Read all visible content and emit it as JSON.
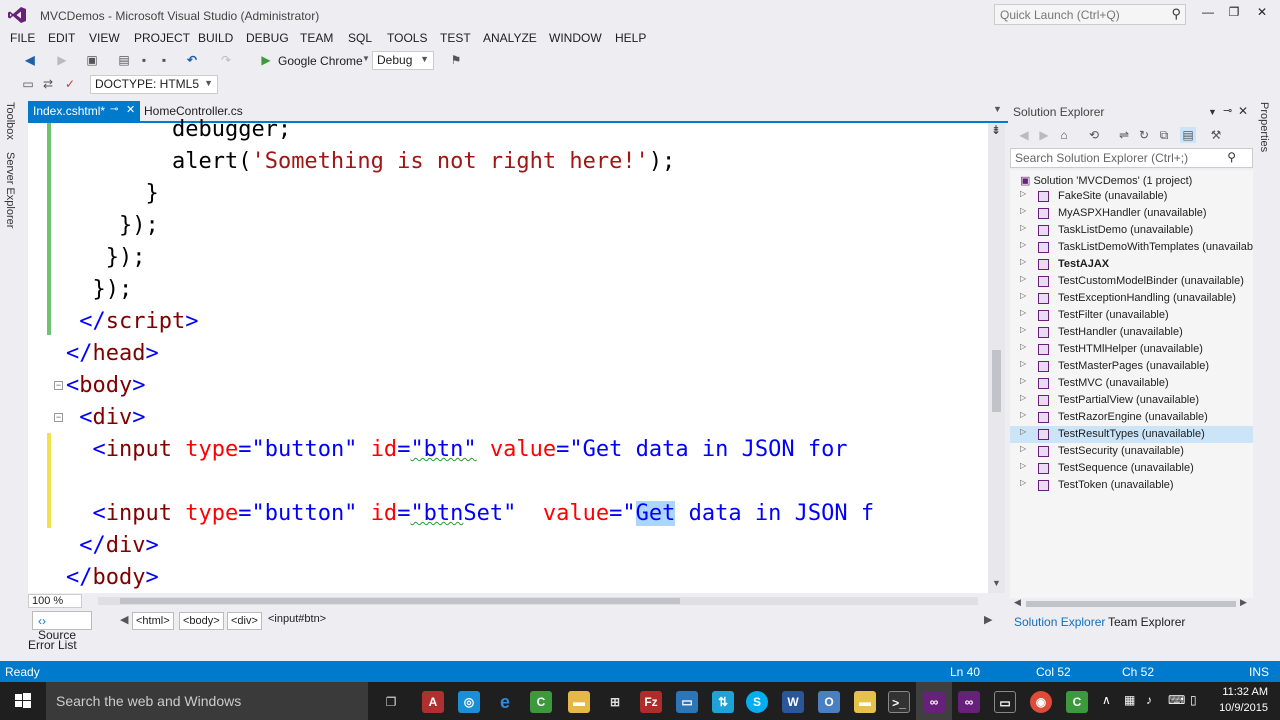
{
  "window": {
    "title": "MVCDemos - Microsoft Visual Studio (Administrator)",
    "quick_launch_placeholder": "Quick Launch (Ctrl+Q)"
  },
  "menu": [
    "FILE",
    "EDIT",
    "VIEW",
    "PROJECT",
    "BUILD",
    "DEBUG",
    "TEAM",
    "SQL",
    "TOOLS",
    "TEST",
    "ANALYZE",
    "WINDOW",
    "HELP"
  ],
  "toolbar": {
    "browser": "Google Chrome",
    "configuration": "Debug",
    "doctype": "DOCTYPE: HTML5"
  },
  "side_tabs": {
    "toolbox": "Toolbox",
    "server_explorer": "Server Explorer",
    "properties": "Properties"
  },
  "tabs": {
    "active": "Index.cshtml*",
    "second": "HomeController.cs"
  },
  "code": {
    "l1": "debugger;",
    "l2_fn": "alert(",
    "l2_str": "'Something is not right here!'",
    "l2_end": ");",
    "l3": "}",
    "l4": "});",
    "l5": "});",
    "l6": "});",
    "script_close": "script",
    "head_close": "head",
    "body_open": "body",
    "div_open": "div",
    "input_tag": "input",
    "type_attr": "type",
    "type_val": "\"button\"",
    "id_attr": "id",
    "id1": "\"btn\"",
    "value_attr": "value",
    "value1": "\"Get data in JSON for",
    "id2_pre": "\"btn",
    "id2_post": "Set\"",
    "value2_open": "\"",
    "value2_sel": "Get",
    "value2_rest": " data in JSON f",
    "div_close": "div",
    "body_close": "body"
  },
  "editor_footer": {
    "zoom": "100 %",
    "source": "Source",
    "crumbs": [
      "<html>",
      "<body>",
      "<div>",
      "<input#btn>"
    ],
    "error_list": "Error List"
  },
  "solution_explorer": {
    "title": "Solution Explorer",
    "search_placeholder": "Search Solution Explorer (Ctrl+;)",
    "root": "Solution 'MVCDemos' (1 project)",
    "items": [
      "FakeSite (unavailable)",
      "MyASPXHandler (unavailable)",
      "TaskListDemo (unavailable)",
      "TaskListDemoWithTemplates (unavailab",
      "TestAJAX",
      "TestCustomModelBinder (unavailable)",
      "TestExceptionHandling (unavailable)",
      "TestFilter (unavailable)",
      "TestHandler (unavailable)",
      "TestHTMlHelper (unavailable)",
      "TestMasterPages (unavailable)",
      "TestMVC (unavailable)",
      "TestPartialView (unavailable)",
      "TestRazorEngine (unavailable)",
      "TestResultTypes (unavailable)",
      "TestSecurity (unavailable)",
      "TestSequence (unavailable)",
      "TestToken (unavailable)"
    ],
    "tab_active": "Solution Explorer",
    "tab_second": "Team Explorer"
  },
  "status": {
    "ready": "Ready",
    "ln": "Ln 40",
    "col": "Col 52",
    "ch": "Ch 52",
    "ins": "INS"
  },
  "taskbar": {
    "search_placeholder": "Search the web and Windows",
    "time": "11:32 AM",
    "date": "10/9/2015"
  },
  "colors": {
    "accent": "#007acc",
    "tag": "#800000",
    "attribute": "#ff0000",
    "value": "#0000ff",
    "string": "#a31515"
  }
}
